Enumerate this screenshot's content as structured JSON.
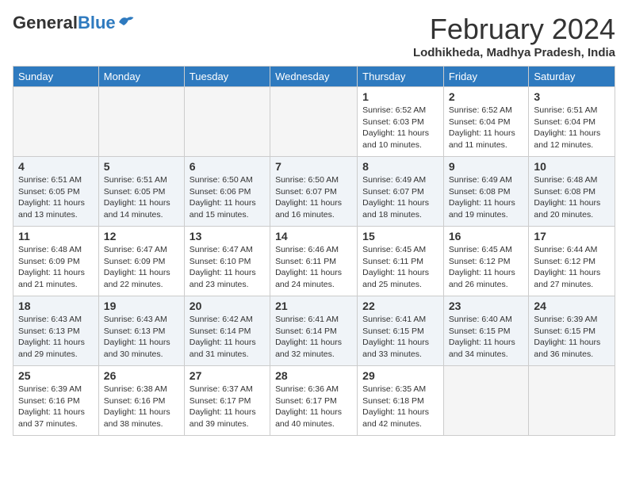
{
  "header": {
    "logo_general": "General",
    "logo_blue": "Blue",
    "month_title": "February 2024",
    "location": "Lodhikheda, Madhya Pradesh, India"
  },
  "weekdays": [
    "Sunday",
    "Monday",
    "Tuesday",
    "Wednesday",
    "Thursday",
    "Friday",
    "Saturday"
  ],
  "weeks": [
    [
      {
        "day": "",
        "sunrise": "",
        "sunset": "",
        "daylight": ""
      },
      {
        "day": "",
        "sunrise": "",
        "sunset": "",
        "daylight": ""
      },
      {
        "day": "",
        "sunrise": "",
        "sunset": "",
        "daylight": ""
      },
      {
        "day": "",
        "sunrise": "",
        "sunset": "",
        "daylight": ""
      },
      {
        "day": "1",
        "sunrise": "Sunrise: 6:52 AM",
        "sunset": "Sunset: 6:03 PM",
        "daylight": "Daylight: 11 hours and 10 minutes."
      },
      {
        "day": "2",
        "sunrise": "Sunrise: 6:52 AM",
        "sunset": "Sunset: 6:04 PM",
        "daylight": "Daylight: 11 hours and 11 minutes."
      },
      {
        "day": "3",
        "sunrise": "Sunrise: 6:51 AM",
        "sunset": "Sunset: 6:04 PM",
        "daylight": "Daylight: 11 hours and 12 minutes."
      }
    ],
    [
      {
        "day": "4",
        "sunrise": "Sunrise: 6:51 AM",
        "sunset": "Sunset: 6:05 PM",
        "daylight": "Daylight: 11 hours and 13 minutes."
      },
      {
        "day": "5",
        "sunrise": "Sunrise: 6:51 AM",
        "sunset": "Sunset: 6:05 PM",
        "daylight": "Daylight: 11 hours and 14 minutes."
      },
      {
        "day": "6",
        "sunrise": "Sunrise: 6:50 AM",
        "sunset": "Sunset: 6:06 PM",
        "daylight": "Daylight: 11 hours and 15 minutes."
      },
      {
        "day": "7",
        "sunrise": "Sunrise: 6:50 AM",
        "sunset": "Sunset: 6:07 PM",
        "daylight": "Daylight: 11 hours and 16 minutes."
      },
      {
        "day": "8",
        "sunrise": "Sunrise: 6:49 AM",
        "sunset": "Sunset: 6:07 PM",
        "daylight": "Daylight: 11 hours and 18 minutes."
      },
      {
        "day": "9",
        "sunrise": "Sunrise: 6:49 AM",
        "sunset": "Sunset: 6:08 PM",
        "daylight": "Daylight: 11 hours and 19 minutes."
      },
      {
        "day": "10",
        "sunrise": "Sunrise: 6:48 AM",
        "sunset": "Sunset: 6:08 PM",
        "daylight": "Daylight: 11 hours and 20 minutes."
      }
    ],
    [
      {
        "day": "11",
        "sunrise": "Sunrise: 6:48 AM",
        "sunset": "Sunset: 6:09 PM",
        "daylight": "Daylight: 11 hours and 21 minutes."
      },
      {
        "day": "12",
        "sunrise": "Sunrise: 6:47 AM",
        "sunset": "Sunset: 6:09 PM",
        "daylight": "Daylight: 11 hours and 22 minutes."
      },
      {
        "day": "13",
        "sunrise": "Sunrise: 6:47 AM",
        "sunset": "Sunset: 6:10 PM",
        "daylight": "Daylight: 11 hours and 23 minutes."
      },
      {
        "day": "14",
        "sunrise": "Sunrise: 6:46 AM",
        "sunset": "Sunset: 6:11 PM",
        "daylight": "Daylight: 11 hours and 24 minutes."
      },
      {
        "day": "15",
        "sunrise": "Sunrise: 6:45 AM",
        "sunset": "Sunset: 6:11 PM",
        "daylight": "Daylight: 11 hours and 25 minutes."
      },
      {
        "day": "16",
        "sunrise": "Sunrise: 6:45 AM",
        "sunset": "Sunset: 6:12 PM",
        "daylight": "Daylight: 11 hours and 26 minutes."
      },
      {
        "day": "17",
        "sunrise": "Sunrise: 6:44 AM",
        "sunset": "Sunset: 6:12 PM",
        "daylight": "Daylight: 11 hours and 27 minutes."
      }
    ],
    [
      {
        "day": "18",
        "sunrise": "Sunrise: 6:43 AM",
        "sunset": "Sunset: 6:13 PM",
        "daylight": "Daylight: 11 hours and 29 minutes."
      },
      {
        "day": "19",
        "sunrise": "Sunrise: 6:43 AM",
        "sunset": "Sunset: 6:13 PM",
        "daylight": "Daylight: 11 hours and 30 minutes."
      },
      {
        "day": "20",
        "sunrise": "Sunrise: 6:42 AM",
        "sunset": "Sunset: 6:14 PM",
        "daylight": "Daylight: 11 hours and 31 minutes."
      },
      {
        "day": "21",
        "sunrise": "Sunrise: 6:41 AM",
        "sunset": "Sunset: 6:14 PM",
        "daylight": "Daylight: 11 hours and 32 minutes."
      },
      {
        "day": "22",
        "sunrise": "Sunrise: 6:41 AM",
        "sunset": "Sunset: 6:15 PM",
        "daylight": "Daylight: 11 hours and 33 minutes."
      },
      {
        "day": "23",
        "sunrise": "Sunrise: 6:40 AM",
        "sunset": "Sunset: 6:15 PM",
        "daylight": "Daylight: 11 hours and 34 minutes."
      },
      {
        "day": "24",
        "sunrise": "Sunrise: 6:39 AM",
        "sunset": "Sunset: 6:15 PM",
        "daylight": "Daylight: 11 hours and 36 minutes."
      }
    ],
    [
      {
        "day": "25",
        "sunrise": "Sunrise: 6:39 AM",
        "sunset": "Sunset: 6:16 PM",
        "daylight": "Daylight: 11 hours and 37 minutes."
      },
      {
        "day": "26",
        "sunrise": "Sunrise: 6:38 AM",
        "sunset": "Sunset: 6:16 PM",
        "daylight": "Daylight: 11 hours and 38 minutes."
      },
      {
        "day": "27",
        "sunrise": "Sunrise: 6:37 AM",
        "sunset": "Sunset: 6:17 PM",
        "daylight": "Daylight: 11 hours and 39 minutes."
      },
      {
        "day": "28",
        "sunrise": "Sunrise: 6:36 AM",
        "sunset": "Sunset: 6:17 PM",
        "daylight": "Daylight: 11 hours and 40 minutes."
      },
      {
        "day": "29",
        "sunrise": "Sunrise: 6:35 AM",
        "sunset": "Sunset: 6:18 PM",
        "daylight": "Daylight: 11 hours and 42 minutes."
      },
      {
        "day": "",
        "sunrise": "",
        "sunset": "",
        "daylight": ""
      },
      {
        "day": "",
        "sunrise": "",
        "sunset": "",
        "daylight": ""
      }
    ]
  ]
}
